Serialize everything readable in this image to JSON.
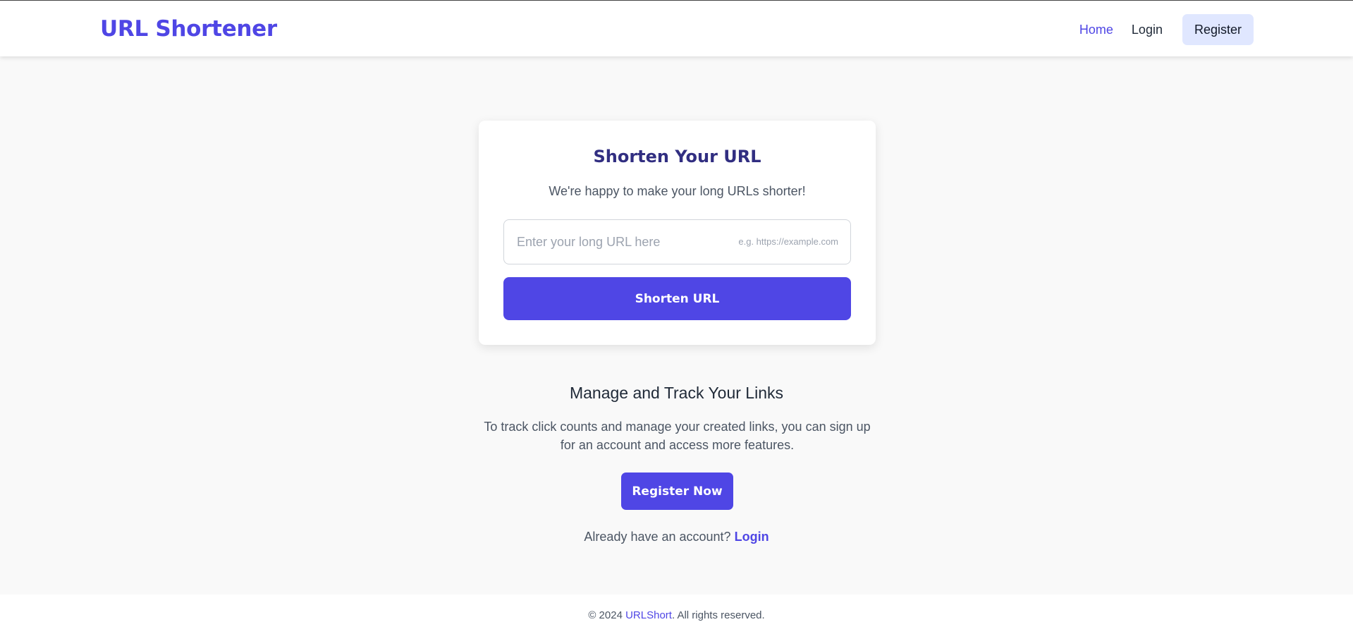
{
  "header": {
    "brand": "URL Shortener",
    "nav": {
      "home": "Home",
      "login": "Login",
      "register": "Register"
    }
  },
  "shortener_card": {
    "title": "Shorten Your URL",
    "subtitle": "We're happy to make your long URLs shorter!",
    "input_placeholder": "Enter your long URL here",
    "input_value": "",
    "input_hint": "e.g. https://example.com",
    "submit_label": "Shorten URL"
  },
  "manage_section": {
    "title": "Manage and Track Your Links",
    "description": "To track click counts and manage your created links, you can sign up for an account and access more features.",
    "register_button": "Register Now",
    "login_prompt": "Already have an account?",
    "login_link": "Login"
  },
  "footer": {
    "prefix": "© 2024",
    "brand": "URLShort",
    "suffix": ". All rights reserved."
  },
  "colors": {
    "accent": "#4f46e5",
    "title_dark": "#312e81",
    "nav_register_bg": "#e0e7ff",
    "page_bg": "#f9f9f9"
  }
}
